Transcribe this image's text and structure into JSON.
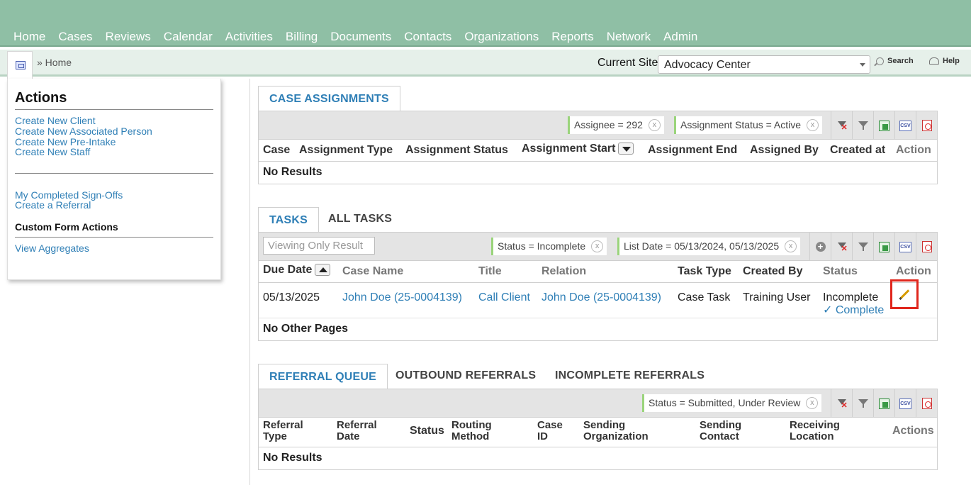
{
  "nav": [
    "Home",
    "Cases",
    "Reviews",
    "Calendar",
    "Activities",
    "Billing",
    "Documents",
    "Contacts",
    "Organizations",
    "Reports",
    "Network",
    "Admin"
  ],
  "breadcrumb": "» Home",
  "site": {
    "label": "Current Site",
    "value": "Advocacy Center"
  },
  "toolbar_links": {
    "search": "Search",
    "help": "Help"
  },
  "actions": {
    "title": "Actions",
    "group1": [
      "Create New Client",
      "Create New Associated Person",
      "Create New Pre-Intake",
      "Create New Staff"
    ],
    "group2": [
      "My Completed Sign-Offs",
      "Create a Referral"
    ],
    "custom_heading": "Custom Form Actions",
    "group3": [
      "View Aggregates"
    ]
  },
  "case_assignments": {
    "tab": "CASE ASSIGNMENTS",
    "filters": [
      "Assignee = 292",
      "Assignment Status = Active"
    ],
    "columns": [
      "Case",
      "Assignment Type",
      "Assignment Status",
      "Assignment Start",
      "Assignment End",
      "Assigned By",
      "Created at",
      "Action"
    ],
    "empty": "No Results"
  },
  "tasks": {
    "tabs": [
      "TASKS",
      "ALL TASKS"
    ],
    "viewing": "Viewing Only Result",
    "filters": [
      "Status = Incomplete",
      "List Date = 05/13/2024, 05/13/2025"
    ],
    "columns": [
      "Due Date",
      "Case Name",
      "Title",
      "Relation",
      "Task Type",
      "Created By",
      "Status",
      "Action"
    ],
    "row": {
      "due": "05/13/2025",
      "case_name": "John Doe (25-0004139)",
      "title": "Call Client",
      "relation": "John Doe (25-0004139)",
      "task_type": "Case Task",
      "created_by": "Training User",
      "status": "Incomplete",
      "complete": "✓ Complete"
    },
    "footer": "No Other Pages"
  },
  "referrals": {
    "tabs": [
      "REFERRAL QUEUE",
      "OUTBOUND REFERRALS",
      "INCOMPLETE REFERRALS"
    ],
    "filters": [
      "Status = Submitted, Under Review"
    ],
    "columns": [
      {
        "l1": "Referral",
        "l2": "Type"
      },
      {
        "l1": "Referral",
        "l2": "Date"
      },
      {
        "l1": "Status",
        "l2": ""
      },
      {
        "l1": "Routing",
        "l2": "Method"
      },
      {
        "l1": "Case",
        "l2": "ID"
      },
      {
        "l1": "Sending",
        "l2": "Organization"
      },
      {
        "l1": "Sending",
        "l2": "Contact"
      },
      {
        "l1": "Receiving",
        "l2": "Location"
      },
      {
        "l1": "Actions",
        "l2": ""
      }
    ],
    "empty": "No Results"
  },
  "icons": {
    "clear_filter": "clear-filter-icon",
    "filter": "filter-icon",
    "excel": "excel-export-icon",
    "csv": "csv-export-icon",
    "pdf": "pdf-export-icon",
    "edit": "pencil-icon"
  },
  "colors": {
    "nav_bg": "#8fbfa5",
    "link": "#2f7fb6",
    "highlight": "#e0261c"
  }
}
